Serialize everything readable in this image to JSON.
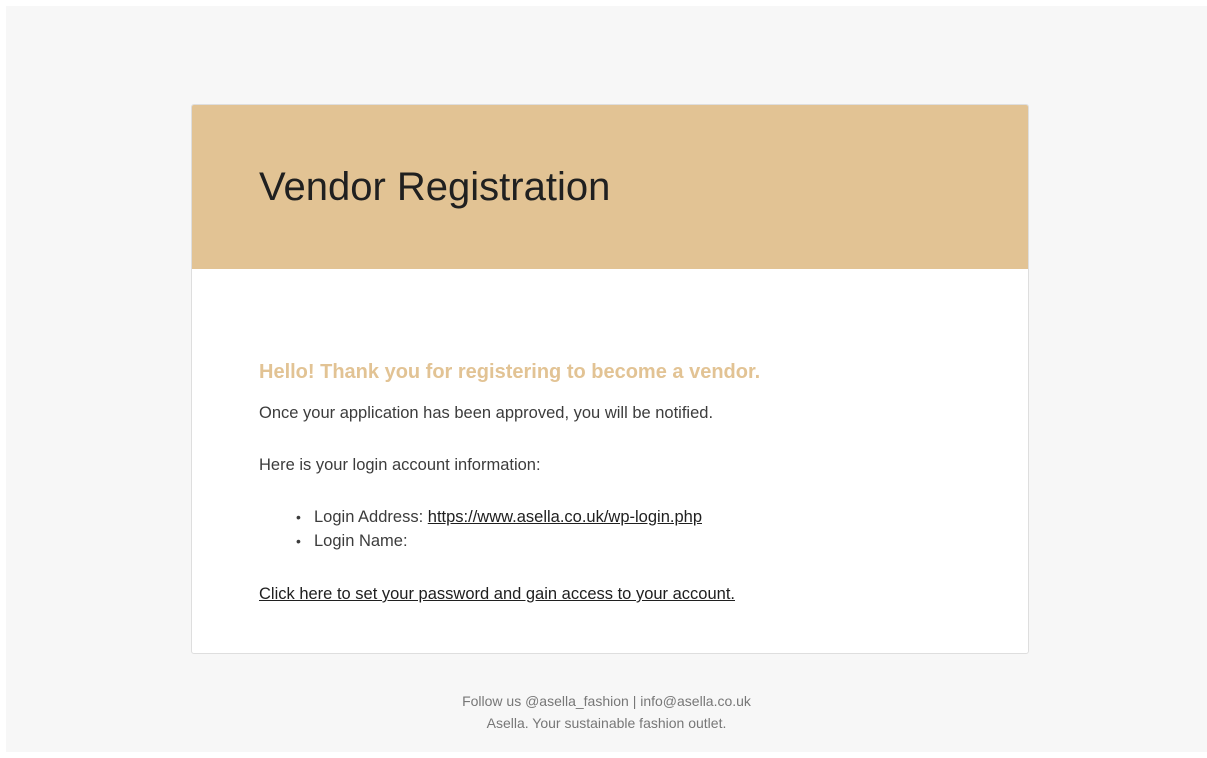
{
  "email": {
    "header_title": "Vendor Registration",
    "greeting": "Hello! Thank you for registering to become a vendor.",
    "approval_note": "Once your application has been approved, you will be notified.",
    "login_info_intro": "Here is your login account information:",
    "login_details": {
      "address_label": "Login Address:",
      "address_url": "https://www.asella.co.uk/wp-login.php",
      "name_label": "Login Name:"
    },
    "set_password_link": "Click here to set your password and gain access to your account."
  },
  "footer": {
    "line1": "Follow us @asella_fashion | info@asella.co.uk",
    "line2": "Asella. Your sustainable fashion outlet."
  },
  "colors": {
    "header_bg": "#e2c394",
    "greeting_text": "#e2c394",
    "page_bg": "#f7f7f7"
  }
}
